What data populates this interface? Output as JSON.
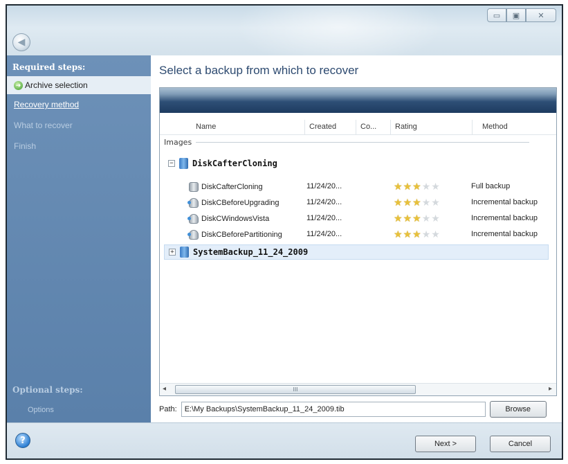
{
  "window": {
    "minimize": "▭",
    "maximize": "▣",
    "close": "✕"
  },
  "sidebar": {
    "required_heading": "Required steps:",
    "items": [
      {
        "label": "Archive selection",
        "state": "active"
      },
      {
        "label": "Recovery method",
        "state": "link"
      },
      {
        "label": "What to recover",
        "state": "dim"
      },
      {
        "label": "Finish",
        "state": "dim"
      }
    ],
    "optional_heading": "Optional steps:",
    "optional_items": [
      {
        "label": "Options"
      }
    ]
  },
  "main": {
    "title": "Select a backup from which to recover",
    "columns": [
      "Name",
      "Created",
      "Co...",
      "Rating",
      "Method"
    ],
    "group_label": "Images",
    "nodes": [
      {
        "name": "DiskCafterCloning",
        "expander": "−",
        "children": [
          {
            "name": "DiskCafterCloning",
            "created": "11/24/20...",
            "rating": 3,
            "method": "Full backup",
            "icon": "full"
          },
          {
            "name": "DiskCBeforeUpgrading",
            "created": "11/24/20...",
            "rating": 3,
            "method": "Incremental backup",
            "icon": "incremental"
          },
          {
            "name": "DiskCWindowsVista",
            "created": "11/24/20...",
            "rating": 3,
            "method": "Incremental backup",
            "icon": "incremental"
          },
          {
            "name": "DiskCBeforePartitioning",
            "created": "11/24/20...",
            "rating": 3,
            "method": "Incremental backup",
            "icon": "incremental"
          }
        ]
      },
      {
        "name": "SystemBackup_11_24_2009",
        "expander": "+",
        "selected": true
      }
    ],
    "scroll": {
      "left": "◂",
      "right": "▸",
      "grip": "III"
    },
    "path_label": "Path:",
    "path_value": "E:\\My Backups\\SystemBackup_11_24_2009.tib",
    "browse_label": "Browse"
  },
  "footer": {
    "help": "?",
    "next_label": "Next >",
    "cancel_label": "Cancel"
  },
  "icons": {
    "back": "arrow-left-icon",
    "help": "help-icon",
    "disk": "disk-icon",
    "star": "star-icon"
  }
}
